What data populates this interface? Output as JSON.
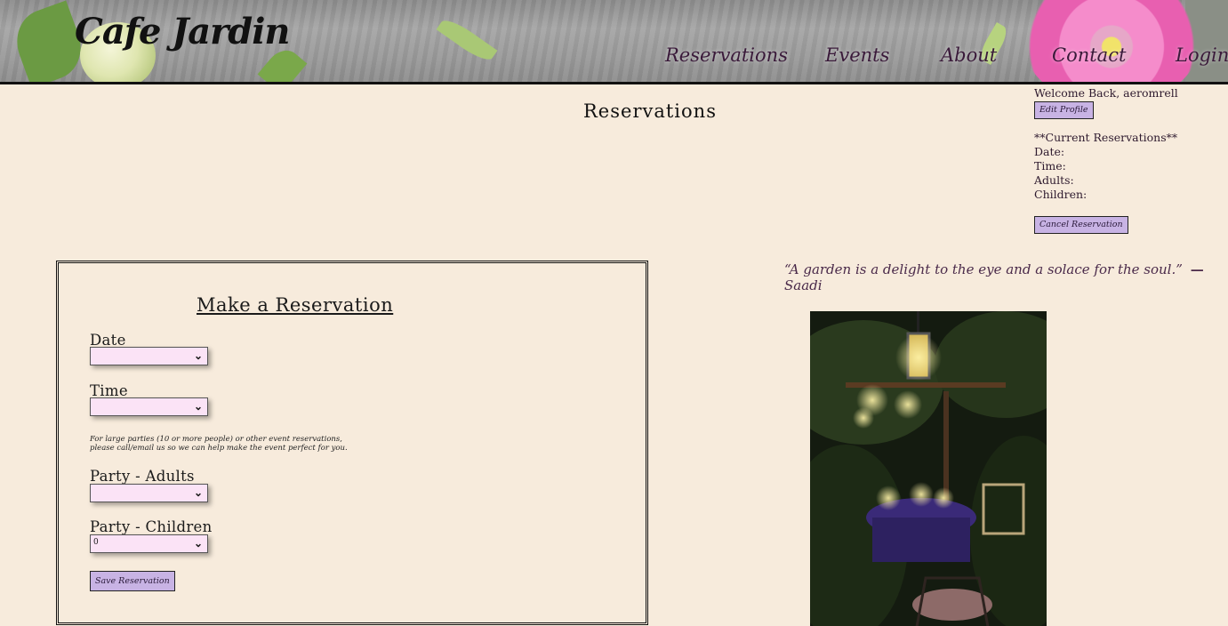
{
  "brand": {
    "logo": "Cafe Jardin"
  },
  "nav": {
    "reservations": "Reservations",
    "events": "Events",
    "about": "About",
    "contact": "Contact",
    "login": "Login"
  },
  "page": {
    "title": "Reservations"
  },
  "profile": {
    "welcome": "Welcome Back, aeromrell",
    "edit_label": "Edit Profile",
    "current_heading": "**Current Reservations**",
    "date_label": "Date:",
    "time_label": "Time:",
    "adults_label": "Adults:",
    "children_label": "Children:",
    "cancel_label": "Cancel Reservation"
  },
  "form": {
    "title": "Make a Reservation",
    "date_label": "Date",
    "date_value": "",
    "time_label": "Time",
    "time_value": "",
    "note_line1": "For large parties (10 or more people) or other event reservations,",
    "note_line2": "please call/email us so we can help make the event perfect for you.",
    "adults_label": "Party - Adults",
    "adults_value": "",
    "children_label": "Party - Children",
    "children_value": "0",
    "save_label": "Save Reservation"
  },
  "quote": {
    "text": "“A garden is a delight to the eye and a solace for the soul.”",
    "dash": "—",
    "author": "Saadi"
  },
  "colors": {
    "background": "#f7ebdc",
    "button": "#c8b3e4",
    "select": "#fbe3f6",
    "nav_text": "#3a1a3a"
  }
}
